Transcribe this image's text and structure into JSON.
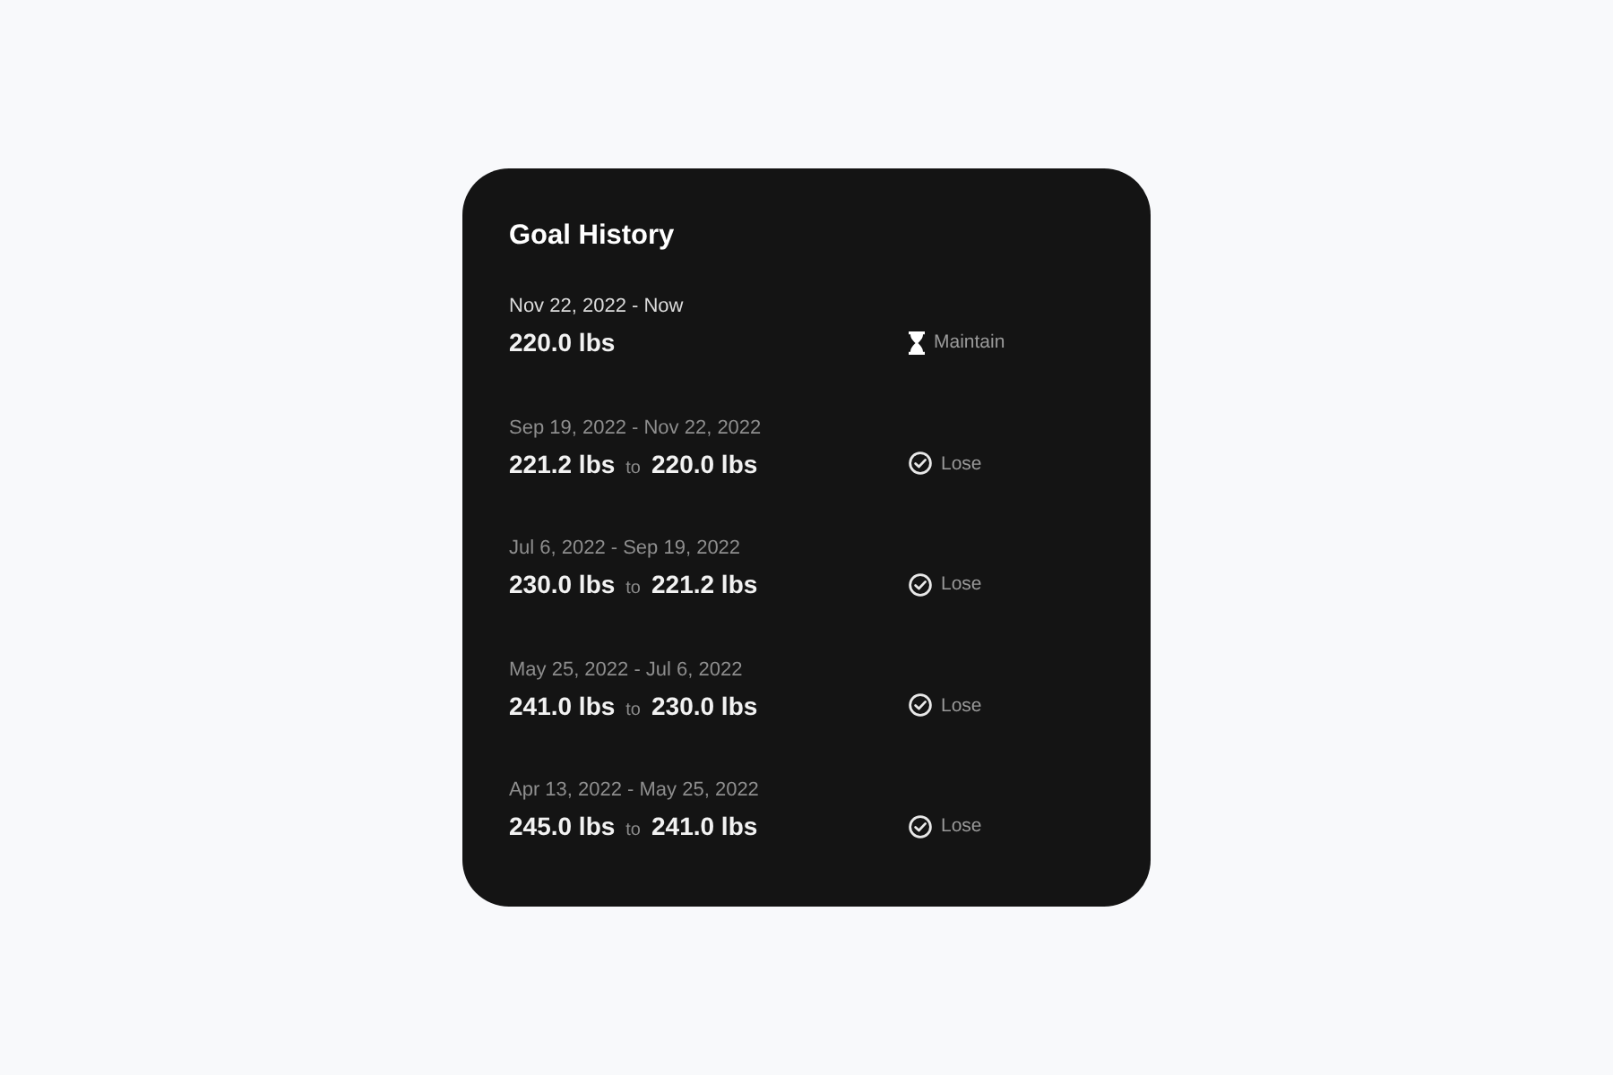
{
  "title": "Goal History",
  "goals": [
    {
      "kind": "current",
      "period": "Nov 22, 2022 - Now",
      "weight": "220.0 lbs",
      "status": "Maintain"
    },
    {
      "kind": "completed",
      "period": "Sep 19, 2022 - Nov 22, 2022",
      "start": "221.2 lbs",
      "connector": "to",
      "end": "220.0 lbs",
      "status": "Lose"
    },
    {
      "kind": "completed",
      "period": "Jul 6, 2022 - Sep 19, 2022",
      "start": "230.0 lbs",
      "connector": "to",
      "end": "221.2 lbs",
      "status": "Lose"
    },
    {
      "kind": "completed",
      "period": "May 25, 2022 - Jul 6, 2022",
      "start": "241.0 lbs",
      "connector": "to",
      "end": "230.0 lbs",
      "status": "Lose"
    },
    {
      "kind": "completed",
      "period": "Apr 13, 2022 - May 25, 2022",
      "start": "245.0 lbs",
      "connector": "to",
      "end": "241.0 lbs",
      "status": "Lose"
    }
  ]
}
